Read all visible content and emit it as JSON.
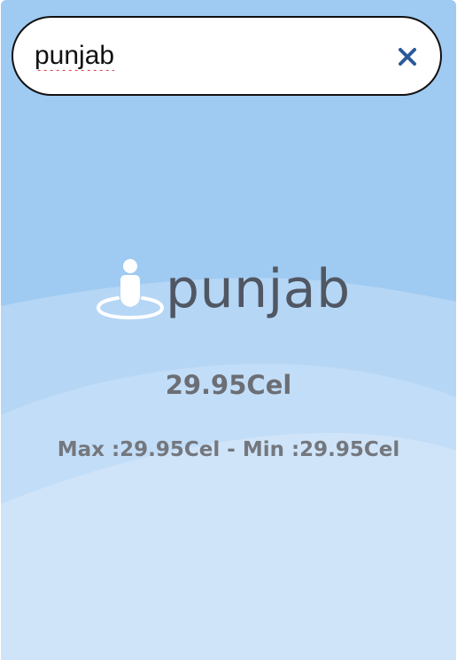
{
  "search": {
    "value": "punjab",
    "clear_icon": "close-icon"
  },
  "weather": {
    "location_icon": "person-pin-icon",
    "city": "punjab",
    "temperature": "29.95Cel",
    "range_text": "Max :29.95Cel - Min :29.95Cel"
  },
  "colors": {
    "background_top": "#9fcaf1",
    "wave_light": "#b9d9f6",
    "wave_lighter": "#c9e2f8",
    "wave_lightest": "#d2e6f9",
    "clear_icon": "#2a5a9a"
  }
}
